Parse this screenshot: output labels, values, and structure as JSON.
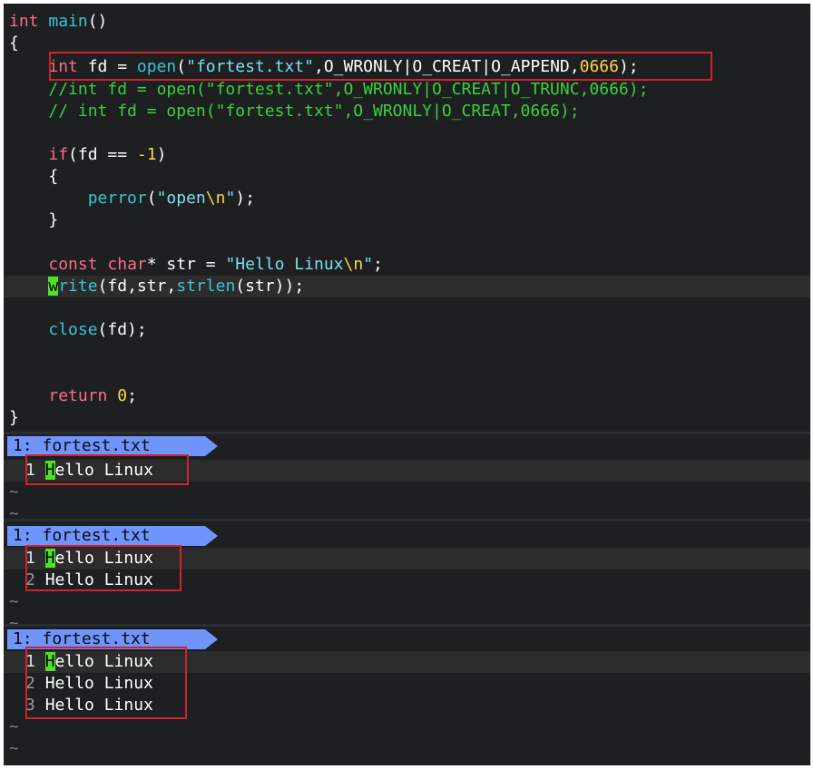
{
  "code": {
    "line1": {
      "kw": "int",
      "fn": "main",
      "rest": "()"
    },
    "line2": "{",
    "line3": {
      "kw": "int",
      "t1": " fd = ",
      "fn": "open",
      "t2": "(",
      "str": "\"fortest.txt\"",
      "t3": ",O_WRONLY|O_CREAT|O_APPEND,",
      "num": "0666",
      "t4": ");"
    },
    "line4": "//int fd = open(\"fortest.txt\",O_WRONLY|O_CREAT|O_TRUNC,0666);",
    "line5": "// int fd = open(\"fortest.txt\",O_WRONLY|O_CREAT,0666);",
    "line7": {
      "kw": "if",
      "t1": "(fd == ",
      "num": "-1",
      "t2": ")"
    },
    "line8": "{",
    "line9": {
      "fn": "perror",
      "t1": "(",
      "str1": "\"open",
      "esc": "\\n",
      "str2": "\"",
      "t2": ");"
    },
    "line10": "}",
    "line12": {
      "kw1": "const",
      "kw2": "char",
      "t1": "* str = ",
      "str1": "\"Hello Linux",
      "esc": "\\n",
      "str2": "\"",
      "t2": ";"
    },
    "line13": {
      "cursor": "w",
      "fn": "rite",
      "t1": "(fd,str,",
      "fn2": "strlen",
      "t2": "(str));"
    },
    "line15": {
      "fn": "close",
      "t1": "(fd);"
    },
    "line18": {
      "kw": "return",
      "t1": " ",
      "num": "0",
      "t2": ";"
    },
    "line19": "}"
  },
  "panes": [
    {
      "tab": "1: fortest.txt",
      "lines": [
        {
          "num": "1",
          "text": "Hello Linux"
        }
      ],
      "tilde": "~"
    },
    {
      "tab": "1: fortest.txt",
      "lines": [
        {
          "num": "1",
          "text": "Hello Linux"
        },
        {
          "num": "2",
          "text": "Hello Linux"
        }
      ],
      "tilde": "~"
    },
    {
      "tab": "1: fortest.txt",
      "lines": [
        {
          "num": "1",
          "text": "Hello Linux"
        },
        {
          "num": "2",
          "text": "Hello Linux"
        },
        {
          "num": "3",
          "text": "Hello Linux"
        }
      ],
      "tilde": "~"
    }
  ],
  "colors": {
    "highlight_box": "#d0232f",
    "tab_bg": "#6f94fc",
    "cursor": "#4fe12a"
  }
}
